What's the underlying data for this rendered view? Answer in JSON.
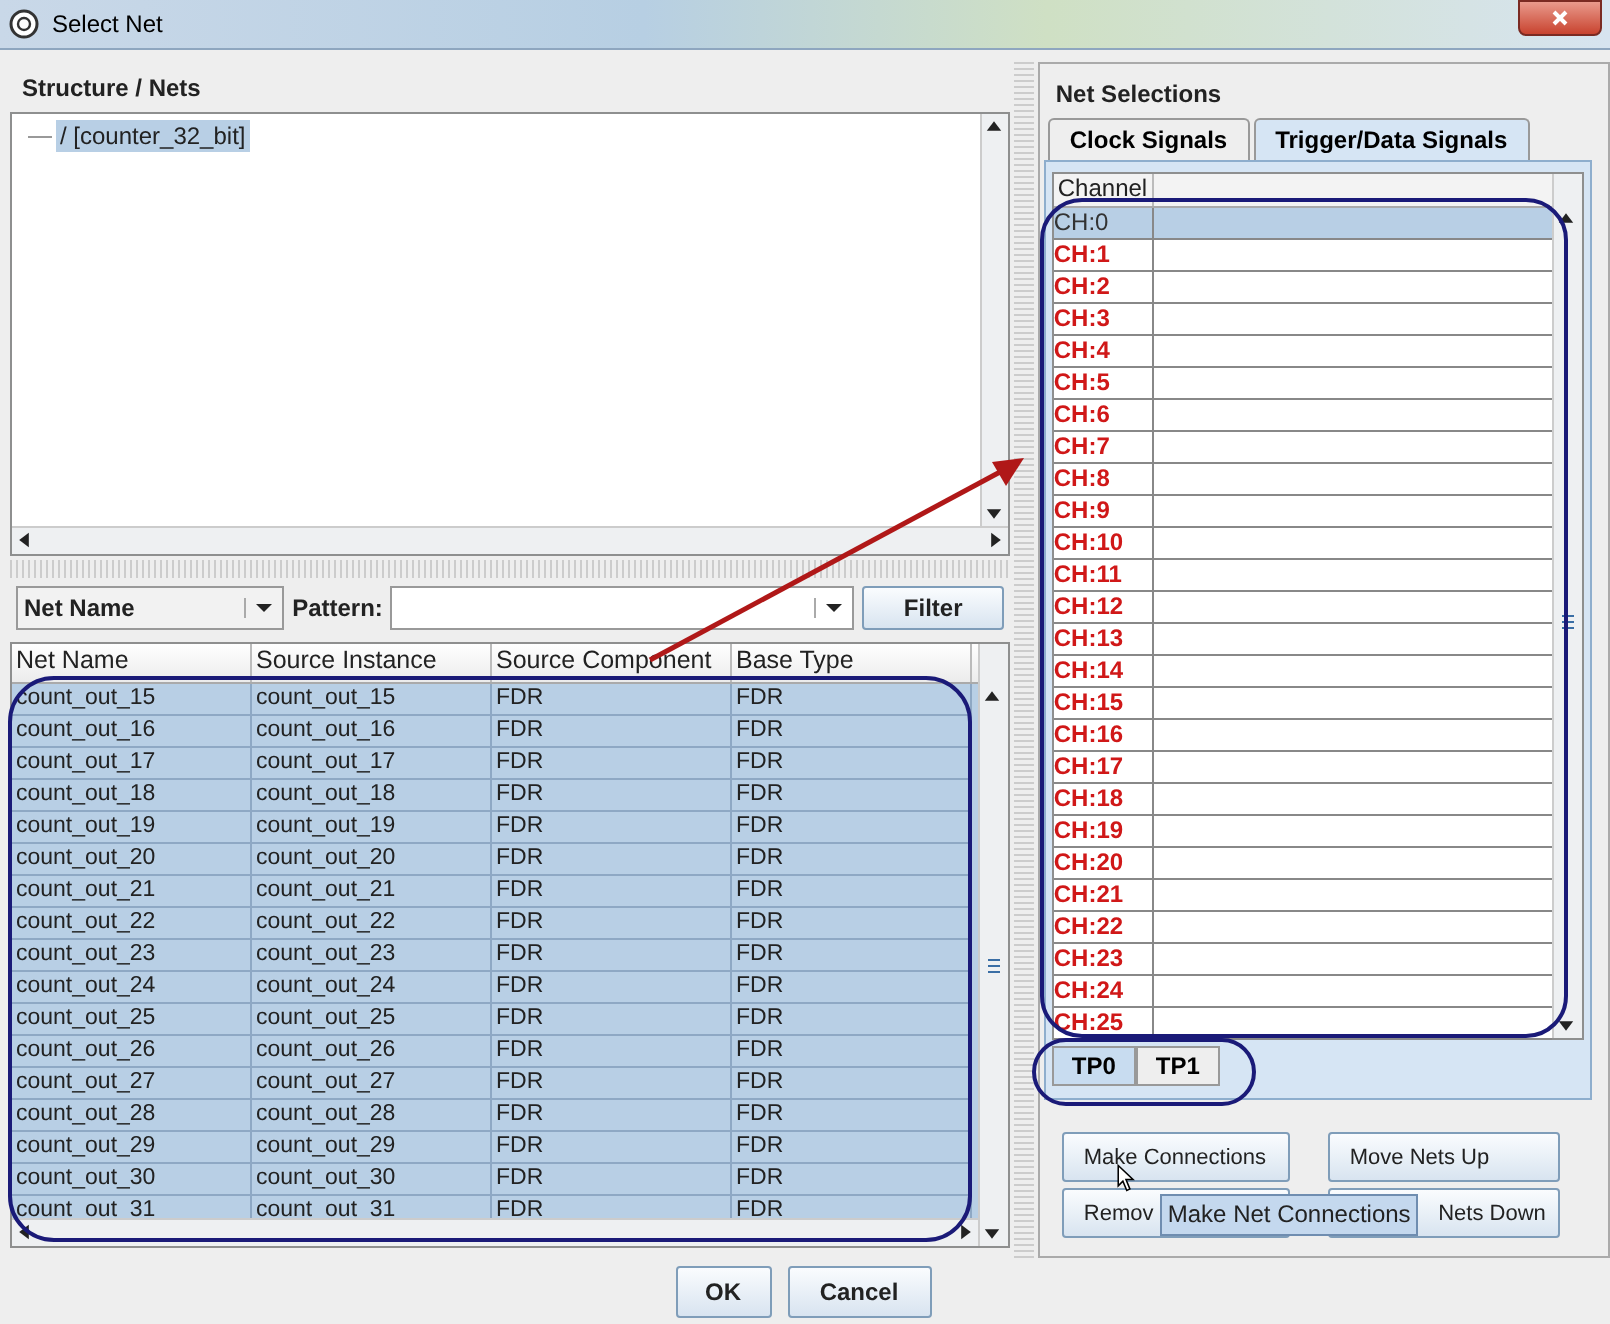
{
  "window": {
    "title": "Select Net"
  },
  "structure": {
    "title": "Structure / Nets",
    "tree": [
      {
        "label": "/ [counter_32_bit]",
        "selected": true
      }
    ]
  },
  "filter": {
    "field": "Net Name",
    "pattern_label": "Pattern:",
    "filter_button": "Filter"
  },
  "nets_table": {
    "columns": [
      "Net Name",
      "Source Instance",
      "Source Component",
      "Base Type"
    ],
    "rows": [
      {
        "cells": [
          "count_out_15",
          "count_out_15",
          "FDR",
          "FDR"
        ],
        "selected": true
      },
      {
        "cells": [
          "count_out_16",
          "count_out_16",
          "FDR",
          "FDR"
        ],
        "selected": true
      },
      {
        "cells": [
          "count_out_17",
          "count_out_17",
          "FDR",
          "FDR"
        ],
        "selected": true
      },
      {
        "cells": [
          "count_out_18",
          "count_out_18",
          "FDR",
          "FDR"
        ],
        "selected": true
      },
      {
        "cells": [
          "count_out_19",
          "count_out_19",
          "FDR",
          "FDR"
        ],
        "selected": true
      },
      {
        "cells": [
          "count_out_20",
          "count_out_20",
          "FDR",
          "FDR"
        ],
        "selected": true
      },
      {
        "cells": [
          "count_out_21",
          "count_out_21",
          "FDR",
          "FDR"
        ],
        "selected": true
      },
      {
        "cells": [
          "count_out_22",
          "count_out_22",
          "FDR",
          "FDR"
        ],
        "selected": true
      },
      {
        "cells": [
          "count_out_23",
          "count_out_23",
          "FDR",
          "FDR"
        ],
        "selected": true
      },
      {
        "cells": [
          "count_out_24",
          "count_out_24",
          "FDR",
          "FDR"
        ],
        "selected": true
      },
      {
        "cells": [
          "count_out_25",
          "count_out_25",
          "FDR",
          "FDR"
        ],
        "selected": true
      },
      {
        "cells": [
          "count_out_26",
          "count_out_26",
          "FDR",
          "FDR"
        ],
        "selected": true
      },
      {
        "cells": [
          "count_out_27",
          "count_out_27",
          "FDR",
          "FDR"
        ],
        "selected": true
      },
      {
        "cells": [
          "count_out_28",
          "count_out_28",
          "FDR",
          "FDR"
        ],
        "selected": true
      },
      {
        "cells": [
          "count_out_29",
          "count_out_29",
          "FDR",
          "FDR"
        ],
        "selected": true
      },
      {
        "cells": [
          "count_out_30",
          "count_out_30",
          "FDR",
          "FDR"
        ],
        "selected": true
      },
      {
        "cells": [
          "count_out_31",
          "count_out_31",
          "FDR",
          "FDR"
        ],
        "selected": true
      }
    ]
  },
  "net_selections": {
    "title": "Net Selections",
    "tabs": [
      {
        "label": "Clock Signals",
        "selected": false
      },
      {
        "label": "Trigger/Data Signals",
        "selected": true
      }
    ],
    "channel_table": {
      "columns": [
        "Channel"
      ],
      "rows": [
        {
          "channel": "CH:0",
          "selected": true
        },
        {
          "channel": "CH:1",
          "selected": false
        },
        {
          "channel": "CH:2",
          "selected": false
        },
        {
          "channel": "CH:3",
          "selected": false
        },
        {
          "channel": "CH:4",
          "selected": false
        },
        {
          "channel": "CH:5",
          "selected": false
        },
        {
          "channel": "CH:6",
          "selected": false
        },
        {
          "channel": "CH:7",
          "selected": false
        },
        {
          "channel": "CH:8",
          "selected": false
        },
        {
          "channel": "CH:9",
          "selected": false
        },
        {
          "channel": "CH:10",
          "selected": false
        },
        {
          "channel": "CH:11",
          "selected": false
        },
        {
          "channel": "CH:12",
          "selected": false
        },
        {
          "channel": "CH:13",
          "selected": false
        },
        {
          "channel": "CH:14",
          "selected": false
        },
        {
          "channel": "CH:15",
          "selected": false
        },
        {
          "channel": "CH:16",
          "selected": false
        },
        {
          "channel": "CH:17",
          "selected": false
        },
        {
          "channel": "CH:18",
          "selected": false
        },
        {
          "channel": "CH:19",
          "selected": false
        },
        {
          "channel": "CH:20",
          "selected": false
        },
        {
          "channel": "CH:21",
          "selected": false
        },
        {
          "channel": "CH:22",
          "selected": false
        },
        {
          "channel": "CH:23",
          "selected": false
        },
        {
          "channel": "CH:24",
          "selected": false
        },
        {
          "channel": "CH:25",
          "selected": false
        }
      ]
    },
    "port_tabs": [
      {
        "label": "TP0",
        "selected": true
      },
      {
        "label": "TP1",
        "selected": false
      }
    ],
    "buttons": [
      "Make Connections",
      "Move Nets Up",
      "Remov",
      "Nets Down"
    ],
    "tooltip": "Make Net Connections"
  },
  "buttons": [
    "OK",
    "Cancel"
  ]
}
